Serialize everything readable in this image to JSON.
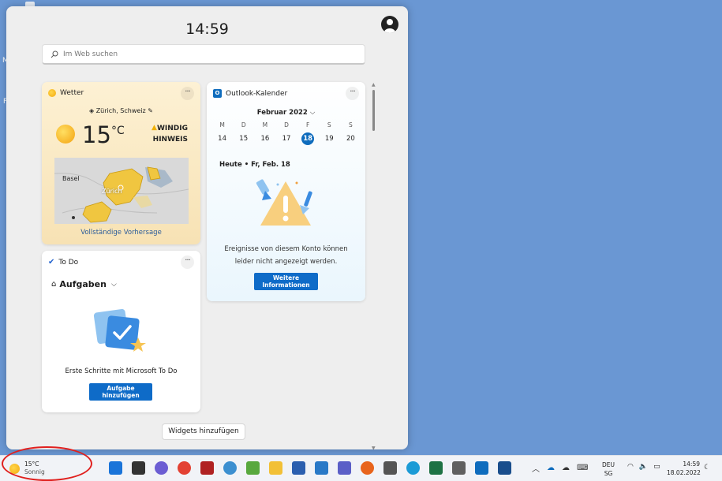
{
  "panel": {
    "clock": "14:59",
    "search_placeholder": "Im Web suchen",
    "add_widgets_label": "Widgets hinzufügen"
  },
  "weather": {
    "title": "Wetter",
    "location": "Zürich, Schweiz",
    "temperature": "15",
    "unit": "°C",
    "warning_line1": "WINDIG",
    "warning_line2": "HINWEIS",
    "map_labels": [
      "Basel",
      "Zürich"
    ],
    "forecast_link": "Vollständige Vorhersage"
  },
  "todo": {
    "title": "To Do",
    "list_name": "Aufgaben",
    "empty_text": "Erste Schritte mit Microsoft To Do",
    "add_button_line1": "Aufgabe",
    "add_button_line2": "hinzufügen"
  },
  "outlook": {
    "title": "Outlook-Kalender",
    "month": "Februar 2022",
    "weekdays": [
      "M",
      "D",
      "M",
      "D",
      "F",
      "S",
      "S"
    ],
    "days": [
      "14",
      "15",
      "16",
      "17",
      "18",
      "19",
      "20"
    ],
    "today_index": 4,
    "today_label": "Heute • Fr, Feb. 18",
    "message_line1": "Ereignisse von diesem Konto können",
    "message_line2": "leider nicht angezeigt werden.",
    "more_button_line1": "Weitere",
    "more_button_line2": "Informationen"
  },
  "taskbar": {
    "weather_temp": "15°C",
    "weather_condition": "Sonnig",
    "lang_line1": "DEU",
    "lang_line2": "SG",
    "time": "14:59",
    "date": "18.02.2022",
    "apps": [
      {
        "name": "start-icon",
        "color": "#1a74d9"
      },
      {
        "name": "task-view-icon",
        "color": "#333333"
      },
      {
        "name": "chat-icon",
        "color": "#6b5dd3"
      },
      {
        "name": "chrome-icon",
        "color": "#e34133"
      },
      {
        "name": "app-red-icon",
        "color": "#b02222"
      },
      {
        "name": "globe-icon",
        "color": "#3c8fd0"
      },
      {
        "name": "image-app-icon",
        "color": "#58a83e"
      },
      {
        "name": "file-explorer-icon",
        "color": "#f2c037"
      },
      {
        "name": "word-icon",
        "color": "#2b5faf"
      },
      {
        "name": "table-app-icon",
        "color": "#2979c7"
      },
      {
        "name": "teams-icon",
        "color": "#5b5fc7"
      },
      {
        "name": "firefox-icon",
        "color": "#e8641c"
      },
      {
        "name": "rss-app-icon",
        "color": "#555555"
      },
      {
        "name": "edge-icon",
        "color": "#1c9bd6"
      },
      {
        "name": "excel-icon",
        "color": "#1e7244"
      },
      {
        "name": "app-gray-icon",
        "color": "#606060"
      },
      {
        "name": "outlook-icon",
        "color": "#0f6cbd"
      },
      {
        "name": "remote-app-icon",
        "color": "#1a4e8c"
      }
    ]
  }
}
